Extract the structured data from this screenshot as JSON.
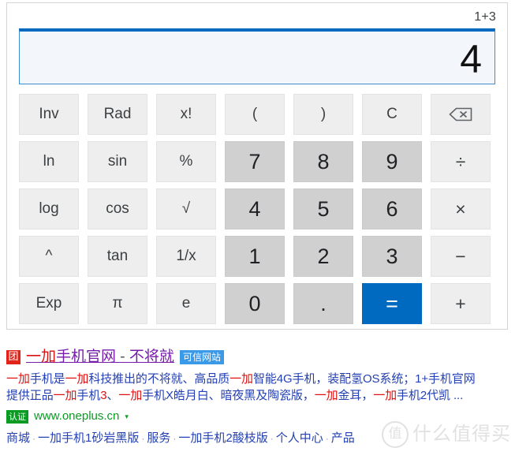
{
  "calculator": {
    "expression": "1+3",
    "result": "4",
    "keys": [
      [
        {
          "label": "Inv",
          "type": "fn",
          "name": "key-inv"
        },
        {
          "label": "Rad",
          "type": "fn",
          "name": "key-rad"
        },
        {
          "label": "x!",
          "type": "fn",
          "name": "key-factorial"
        },
        {
          "label": "(",
          "type": "fn",
          "name": "key-open-paren"
        },
        {
          "label": ")",
          "type": "fn",
          "name": "key-close-paren"
        },
        {
          "label": "C",
          "type": "fn",
          "name": "key-clear"
        },
        {
          "label": "",
          "type": "fn",
          "name": "key-backspace",
          "icon": "backspace-icon"
        }
      ],
      [
        {
          "label": "ln",
          "type": "fn",
          "name": "key-ln"
        },
        {
          "label": "sin",
          "type": "fn",
          "name": "key-sin"
        },
        {
          "label": "%",
          "type": "fn",
          "name": "key-percent"
        },
        {
          "label": "7",
          "type": "num",
          "name": "key-7"
        },
        {
          "label": "8",
          "type": "num",
          "name": "key-8"
        },
        {
          "label": "9",
          "type": "num",
          "name": "key-9"
        },
        {
          "label": "÷",
          "type": "op",
          "name": "key-divide"
        }
      ],
      [
        {
          "label": "log",
          "type": "fn",
          "name": "key-log"
        },
        {
          "label": "cos",
          "type": "fn",
          "name": "key-cos"
        },
        {
          "label": "√",
          "type": "fn",
          "name": "key-sqrt"
        },
        {
          "label": "4",
          "type": "num",
          "name": "key-4"
        },
        {
          "label": "5",
          "type": "num",
          "name": "key-5"
        },
        {
          "label": "6",
          "type": "num",
          "name": "key-6"
        },
        {
          "label": "×",
          "type": "op",
          "name": "key-multiply"
        }
      ],
      [
        {
          "label": "^",
          "type": "fn",
          "name": "key-power"
        },
        {
          "label": "tan",
          "type": "fn",
          "name": "key-tan"
        },
        {
          "label": "1/x",
          "type": "fn",
          "name": "key-reciprocal"
        },
        {
          "label": "1",
          "type": "num",
          "name": "key-1"
        },
        {
          "label": "2",
          "type": "num",
          "name": "key-2"
        },
        {
          "label": "3",
          "type": "num",
          "name": "key-3"
        },
        {
          "label": "−",
          "type": "op",
          "name": "key-minus"
        }
      ],
      [
        {
          "label": "Exp",
          "type": "fn",
          "name": "key-exp"
        },
        {
          "label": "π",
          "type": "fn",
          "name": "key-pi"
        },
        {
          "label": "e",
          "type": "fn",
          "name": "key-e"
        },
        {
          "label": "0",
          "type": "num",
          "name": "key-0"
        },
        {
          "label": ".",
          "type": "dot num",
          "name": "key-decimal"
        },
        {
          "label": "=",
          "type": "eq",
          "name": "key-equals"
        },
        {
          "label": "+",
          "type": "op",
          "name": "key-plus"
        }
      ]
    ],
    "colors": {
      "accent": "#0069c0",
      "display_bg": "#f3f7fb",
      "function_key_bg": "#eeeeee",
      "number_key_bg": "#d0d0d0"
    }
  },
  "search_result": {
    "favicon_glyph": "团",
    "title_parts": [
      {
        "text": "一加",
        "highlight": true
      },
      {
        "text": "手机官网",
        "highlight": false
      },
      {
        "text": " - ",
        "separator": true
      },
      {
        "text": "不将就",
        "highlight": false
      }
    ],
    "title_plain": "一加手机官网 - 不将就",
    "trust_badge": "可信网站",
    "snippet_line1": [
      {
        "text": "一加",
        "highlight": true
      },
      {
        "text": "手机是",
        "highlight": false
      },
      {
        "text": "一加",
        "highlight": true
      },
      {
        "text": "科技推出的不将就、高品质",
        "highlight": false
      },
      {
        "text": "一加",
        "highlight": true
      },
      {
        "text": "智能4G手机，装配氢OS系统；1+手机官网",
        "highlight": false
      }
    ],
    "snippet_line2": [
      {
        "text": "提供正品",
        "highlight": false
      },
      {
        "text": "一加",
        "highlight": true
      },
      {
        "text": "手机",
        "highlight": false
      },
      {
        "text": "3",
        "highlight": true
      },
      {
        "text": "、",
        "highlight": false
      },
      {
        "text": "一加",
        "highlight": true
      },
      {
        "text": "手机X皓月白、暗夜黑及陶瓷版，",
        "highlight": false
      },
      {
        "text": "一加",
        "highlight": true
      },
      {
        "text": "金耳，",
        "highlight": false
      },
      {
        "text": "一加",
        "highlight": true
      },
      {
        "text": "手机2代凯 ...",
        "highlight": false
      }
    ],
    "verified_badge": "认证",
    "url": "www.oneplus.cn",
    "dropdown_caret": "▾",
    "sitelinks": [
      "商城",
      "一加手机1砂岩黑版",
      "服务",
      "一加手机2酸枝版",
      "个人中心",
      "产品"
    ],
    "colors": {
      "visited_link": "#771caa",
      "keyword_highlight": "#dd1111",
      "snippet": "#2440b3",
      "url_green": "#0a9b22",
      "trust_blue": "#3b9ae8"
    }
  },
  "watermark": {
    "logo_glyph": "值",
    "text": "什么值得买"
  }
}
